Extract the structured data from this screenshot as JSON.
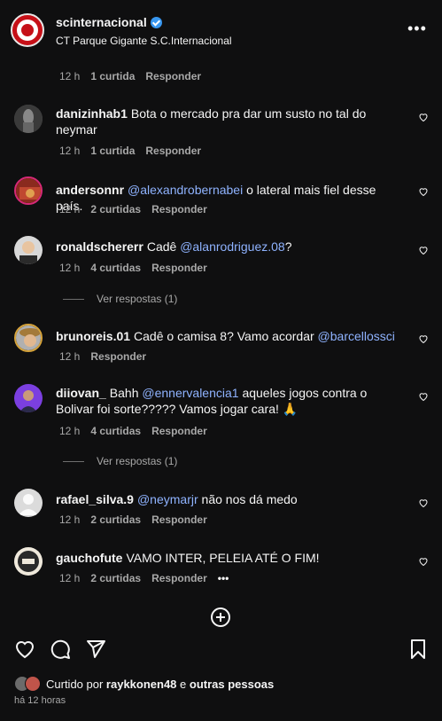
{
  "post": {
    "username": "scinternacional",
    "location": "CT Parque Gigante S.C.Internacional"
  },
  "first_meta": {
    "time": "12 h",
    "likes": "1 curtida",
    "reply": "Responder"
  },
  "comments": [
    {
      "user": "danizinhab1",
      "text": "Bota o mercado pra dar um susto no tal do neymar",
      "time": "12 h",
      "likes": "1 curtida",
      "reply": "Responder"
    },
    {
      "user": "andersonnr",
      "mention": "@alexandrobernabei",
      "text": " o lateral mais fiel desse país.",
      "time": "12 h",
      "likes": "2 curtidas",
      "reply": "Responder"
    },
    {
      "user": "ronaldschererr",
      "pre": "Cadê ",
      "mention": "@alanrodriguez.08",
      "text": "?",
      "time": "12 h",
      "likes": "4 curtidas",
      "reply": "Responder",
      "view_replies": "Ver respostas (1)"
    },
    {
      "user": "brunoreis.01",
      "pre": "Cadê o camisa 8? Vamo acordar ",
      "mention": "@barcellossci",
      "time": "12 h",
      "reply": "Responder"
    },
    {
      "user": "diiovan_",
      "pre": "Bahh ",
      "mention": "@ennervalencia1",
      "text": " aqueles jogos contra o Bolivar foi sorte????? Vamos jogar cara! 🙏",
      "time": "12 h",
      "likes": "4 curtidas",
      "reply": "Responder",
      "view_replies": "Ver respostas (1)"
    },
    {
      "user": "rafael_silva.9",
      "mention": "@neymarjr",
      "text": " não nos dá medo",
      "time": "12 h",
      "likes": "2 curtidas",
      "reply": "Responder"
    },
    {
      "user": "gauchofute",
      "text": "VAMO INTER, PELEIA ATÉ O FIM!",
      "time": "12 h",
      "likes": "2 curtidas",
      "reply": "Responder",
      "more": "•••"
    }
  ],
  "footer": {
    "liked_prefix": "Curtido por ",
    "liked_user": "raykkonen48",
    "liked_mid": " e ",
    "liked_others": "outras pessoas",
    "time_ago": "há 12 horas"
  }
}
